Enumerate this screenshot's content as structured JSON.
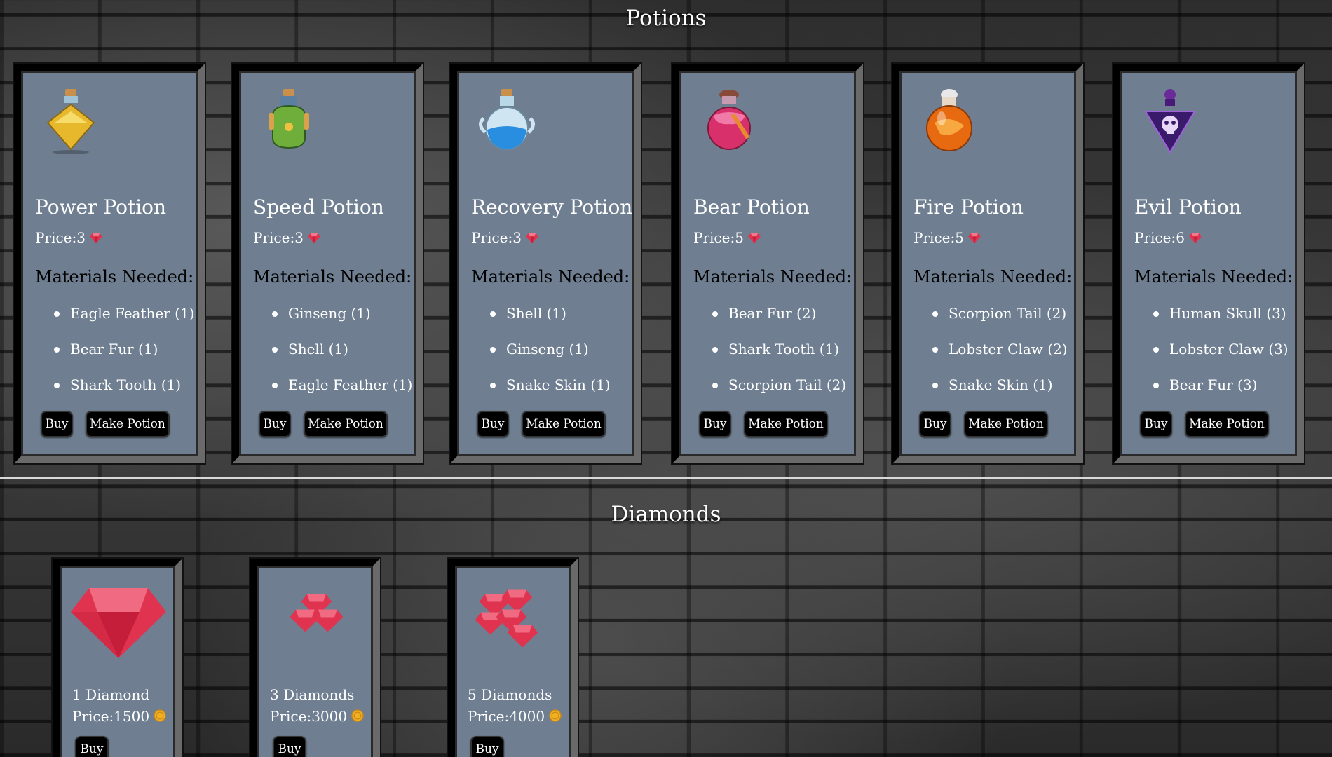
{
  "sections": {
    "potions_title": "Potions",
    "diamonds_title": "Diamonds"
  },
  "potions": [
    {
      "name": "Power Potion",
      "price": "Price:3",
      "currency_icon": "diamond-icon",
      "materials_heading": "Materials Needed:",
      "materials": [
        "Eagle Feather (1)",
        "Bear Fur (1)",
        "Shark Tooth (1)"
      ],
      "buy_label": "Buy",
      "make_label": "Make Potion",
      "icon": "yellow-potion-icon"
    },
    {
      "name": "Speed Potion",
      "price": "Price:3",
      "currency_icon": "diamond-icon",
      "materials_heading": "Materials Needed:",
      "materials": [
        "Ginseng (1)",
        "Shell (1)",
        "Eagle Feather (1)"
      ],
      "buy_label": "Buy",
      "make_label": "Make Potion",
      "icon": "green-potion-icon"
    },
    {
      "name": "Recovery Potion",
      "price": "Price:3",
      "currency_icon": "diamond-icon",
      "materials_heading": "Materials Needed:",
      "materials": [
        "Shell (1)",
        "Ginseng (1)",
        "Snake Skin (1)"
      ],
      "buy_label": "Buy",
      "make_label": "Make Potion",
      "icon": "blue-potion-icon"
    },
    {
      "name": "Bear Potion",
      "price": "Price:5",
      "currency_icon": "diamond-icon",
      "materials_heading": "Materials Needed:",
      "materials": [
        "Bear Fur (2)",
        "Shark Tooth (1)",
        "Scorpion Tail (2)"
      ],
      "buy_label": "Buy",
      "make_label": "Make Potion",
      "icon": "pink-potion-icon"
    },
    {
      "name": "Fire Potion",
      "price": "Price:5",
      "currency_icon": "diamond-icon",
      "materials_heading": "Materials Needed:",
      "materials": [
        "Scorpion Tail (2)",
        "Lobster Claw (2)",
        "Snake Skin (1)"
      ],
      "buy_label": "Buy",
      "make_label": "Make Potion",
      "icon": "orange-potion-icon"
    },
    {
      "name": "Evil Potion",
      "price": "Price:6",
      "currency_icon": "diamond-icon",
      "materials_heading": "Materials Needed:",
      "materials": [
        "Human Skull (3)",
        "Lobster Claw (3)",
        "Bear Fur (3)"
      ],
      "buy_label": "Buy",
      "make_label": "Make Potion",
      "icon": "purple-skull-potion-icon"
    }
  ],
  "diamonds": [
    {
      "name": "1 Diamond",
      "price": "Price:1500",
      "currency_icon": "coin-icon",
      "buy_label": "Buy",
      "icon": "single-diamond-icon"
    },
    {
      "name": "3 Diamonds",
      "price": "Price:3000",
      "currency_icon": "coin-icon",
      "buy_label": "Buy",
      "icon": "three-diamonds-icon"
    },
    {
      "name": "5 Diamonds",
      "price": "Price:4000",
      "currency_icon": "coin-icon",
      "buy_label": "Buy",
      "icon": "five-diamonds-icon"
    }
  ],
  "colors": {
    "card_background": "#6f7f91",
    "gem_red": "#e0334f",
    "coin_gold": "#f0b020"
  }
}
